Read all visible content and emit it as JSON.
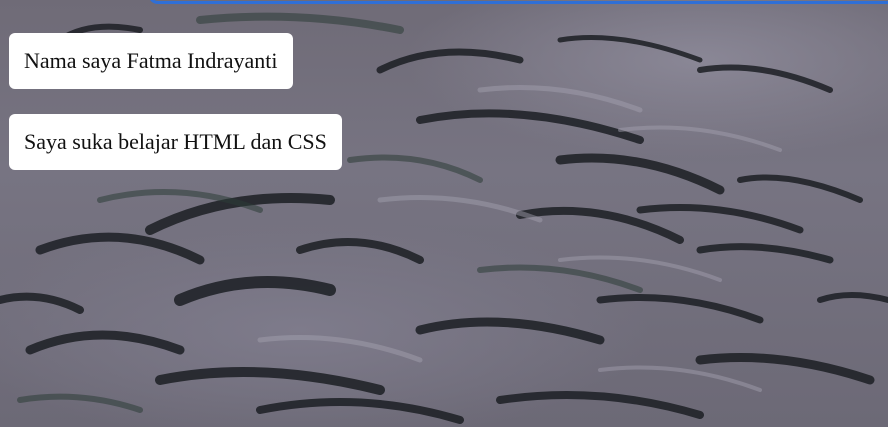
{
  "boxes": {
    "name_text": "Nama saya Fatma Indrayanti",
    "hobby_text": "Saya suka belajar HTML dan CSS"
  },
  "colors": {
    "box_background": "#ffffff",
    "text": "#111111",
    "top_border_accent": "#2f6fd6"
  }
}
